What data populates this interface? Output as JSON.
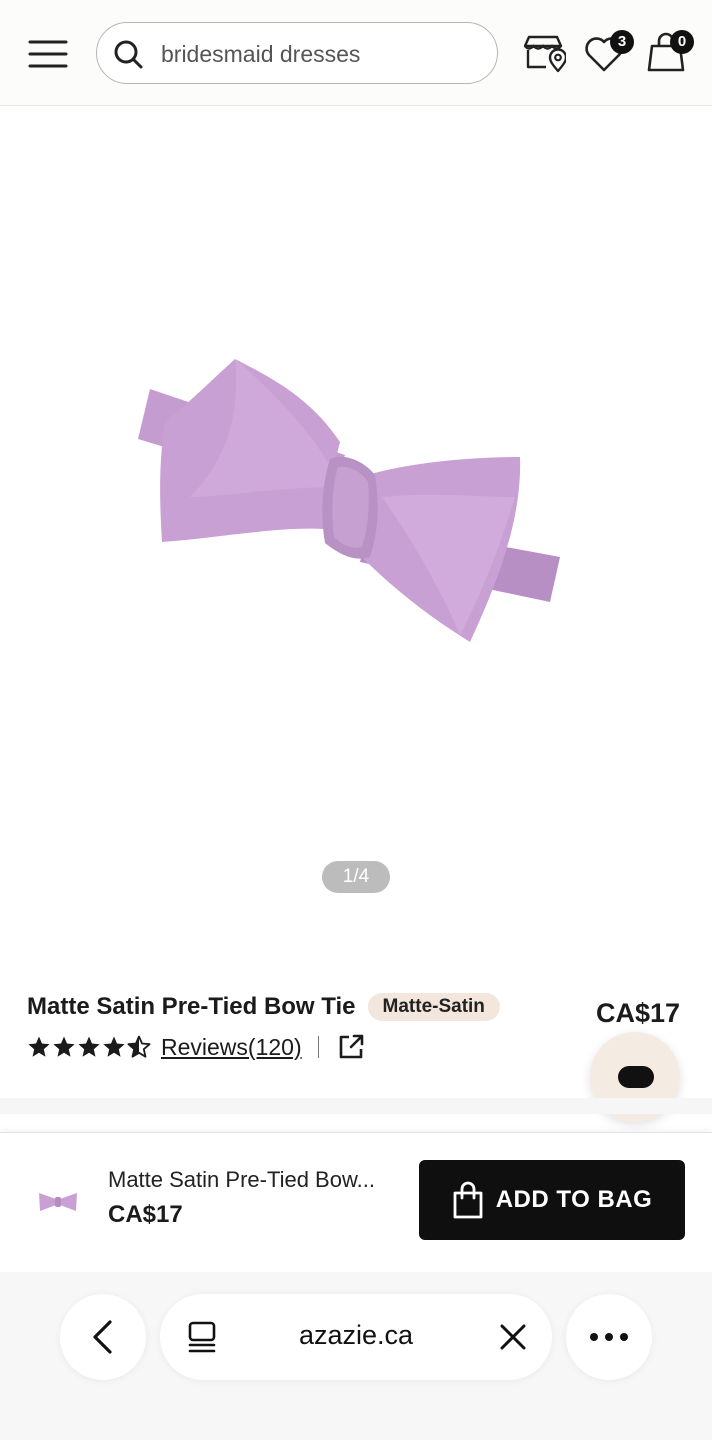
{
  "header": {
    "search_placeholder": "bridesmaid dresses",
    "wishlist_count": "3",
    "bag_count": "0",
    "icons": [
      "menu-icon",
      "search-icon",
      "store-locator-icon",
      "heart-icon",
      "shopping-bag-icon"
    ]
  },
  "gallery": {
    "counter": "1/4",
    "product_color": "#c9a0d4"
  },
  "product": {
    "title": "Matte Satin Pre-Tied Bow Tie",
    "material_tag": "Matte-Satin",
    "price": "CA$17",
    "rating": 4.5,
    "reviews_label": "Reviews(120)"
  },
  "sticky_bar": {
    "name": "Matte Satin Pre-Tied Bow...",
    "price": "CA$17",
    "add_to_bag_label": "ADD TO BAG"
  },
  "browser": {
    "url": "azazie.ca"
  },
  "colors": {
    "accent_dark": "#0f0f0f",
    "tag_bg": "#f2e6dd",
    "chat_bg": "#f4ebe3"
  }
}
